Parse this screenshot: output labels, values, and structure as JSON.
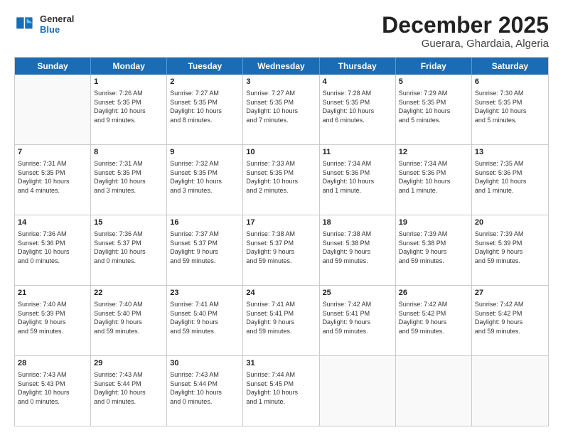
{
  "logo": {
    "line1": "General",
    "line2": "Blue"
  },
  "title": "December 2025",
  "location": "Guerara, Ghardaia, Algeria",
  "header_days": [
    "Sunday",
    "Monday",
    "Tuesday",
    "Wednesday",
    "Thursday",
    "Friday",
    "Saturday"
  ],
  "weeks": [
    [
      {
        "day": "",
        "info": ""
      },
      {
        "day": "1",
        "info": "Sunrise: 7:26 AM\nSunset: 5:35 PM\nDaylight: 10 hours\nand 9 minutes."
      },
      {
        "day": "2",
        "info": "Sunrise: 7:27 AM\nSunset: 5:35 PM\nDaylight: 10 hours\nand 8 minutes."
      },
      {
        "day": "3",
        "info": "Sunrise: 7:27 AM\nSunset: 5:35 PM\nDaylight: 10 hours\nand 7 minutes."
      },
      {
        "day": "4",
        "info": "Sunrise: 7:28 AM\nSunset: 5:35 PM\nDaylight: 10 hours\nand 6 minutes."
      },
      {
        "day": "5",
        "info": "Sunrise: 7:29 AM\nSunset: 5:35 PM\nDaylight: 10 hours\nand 5 minutes."
      },
      {
        "day": "6",
        "info": "Sunrise: 7:30 AM\nSunset: 5:35 PM\nDaylight: 10 hours\nand 5 minutes."
      }
    ],
    [
      {
        "day": "7",
        "info": "Sunrise: 7:31 AM\nSunset: 5:35 PM\nDaylight: 10 hours\nand 4 minutes."
      },
      {
        "day": "8",
        "info": "Sunrise: 7:31 AM\nSunset: 5:35 PM\nDaylight: 10 hours\nand 3 minutes."
      },
      {
        "day": "9",
        "info": "Sunrise: 7:32 AM\nSunset: 5:35 PM\nDaylight: 10 hours\nand 3 minutes."
      },
      {
        "day": "10",
        "info": "Sunrise: 7:33 AM\nSunset: 5:35 PM\nDaylight: 10 hours\nand 2 minutes."
      },
      {
        "day": "11",
        "info": "Sunrise: 7:34 AM\nSunset: 5:36 PM\nDaylight: 10 hours\nand 1 minute."
      },
      {
        "day": "12",
        "info": "Sunrise: 7:34 AM\nSunset: 5:36 PM\nDaylight: 10 hours\nand 1 minute."
      },
      {
        "day": "13",
        "info": "Sunrise: 7:35 AM\nSunset: 5:36 PM\nDaylight: 10 hours\nand 1 minute."
      }
    ],
    [
      {
        "day": "14",
        "info": "Sunrise: 7:36 AM\nSunset: 5:36 PM\nDaylight: 10 hours\nand 0 minutes."
      },
      {
        "day": "15",
        "info": "Sunrise: 7:36 AM\nSunset: 5:37 PM\nDaylight: 10 hours\nand 0 minutes."
      },
      {
        "day": "16",
        "info": "Sunrise: 7:37 AM\nSunset: 5:37 PM\nDaylight: 9 hours\nand 59 minutes."
      },
      {
        "day": "17",
        "info": "Sunrise: 7:38 AM\nSunset: 5:37 PM\nDaylight: 9 hours\nand 59 minutes."
      },
      {
        "day": "18",
        "info": "Sunrise: 7:38 AM\nSunset: 5:38 PM\nDaylight: 9 hours\nand 59 minutes."
      },
      {
        "day": "19",
        "info": "Sunrise: 7:39 AM\nSunset: 5:38 PM\nDaylight: 9 hours\nand 59 minutes."
      },
      {
        "day": "20",
        "info": "Sunrise: 7:39 AM\nSunset: 5:39 PM\nDaylight: 9 hours\nand 59 minutes."
      }
    ],
    [
      {
        "day": "21",
        "info": "Sunrise: 7:40 AM\nSunset: 5:39 PM\nDaylight: 9 hours\nand 59 minutes."
      },
      {
        "day": "22",
        "info": "Sunrise: 7:40 AM\nSunset: 5:40 PM\nDaylight: 9 hours\nand 59 minutes."
      },
      {
        "day": "23",
        "info": "Sunrise: 7:41 AM\nSunset: 5:40 PM\nDaylight: 9 hours\nand 59 minutes."
      },
      {
        "day": "24",
        "info": "Sunrise: 7:41 AM\nSunset: 5:41 PM\nDaylight: 9 hours\nand 59 minutes."
      },
      {
        "day": "25",
        "info": "Sunrise: 7:42 AM\nSunset: 5:41 PM\nDaylight: 9 hours\nand 59 minutes."
      },
      {
        "day": "26",
        "info": "Sunrise: 7:42 AM\nSunset: 5:42 PM\nDaylight: 9 hours\nand 59 minutes."
      },
      {
        "day": "27",
        "info": "Sunrise: 7:42 AM\nSunset: 5:42 PM\nDaylight: 9 hours\nand 59 minutes."
      }
    ],
    [
      {
        "day": "28",
        "info": "Sunrise: 7:43 AM\nSunset: 5:43 PM\nDaylight: 10 hours\nand 0 minutes."
      },
      {
        "day": "29",
        "info": "Sunrise: 7:43 AM\nSunset: 5:44 PM\nDaylight: 10 hours\nand 0 minutes."
      },
      {
        "day": "30",
        "info": "Sunrise: 7:43 AM\nSunset: 5:44 PM\nDaylight: 10 hours\nand 0 minutes."
      },
      {
        "day": "31",
        "info": "Sunrise: 7:44 AM\nSunset: 5:45 PM\nDaylight: 10 hours\nand 1 minute."
      },
      {
        "day": "",
        "info": ""
      },
      {
        "day": "",
        "info": ""
      },
      {
        "day": "",
        "info": ""
      }
    ]
  ]
}
